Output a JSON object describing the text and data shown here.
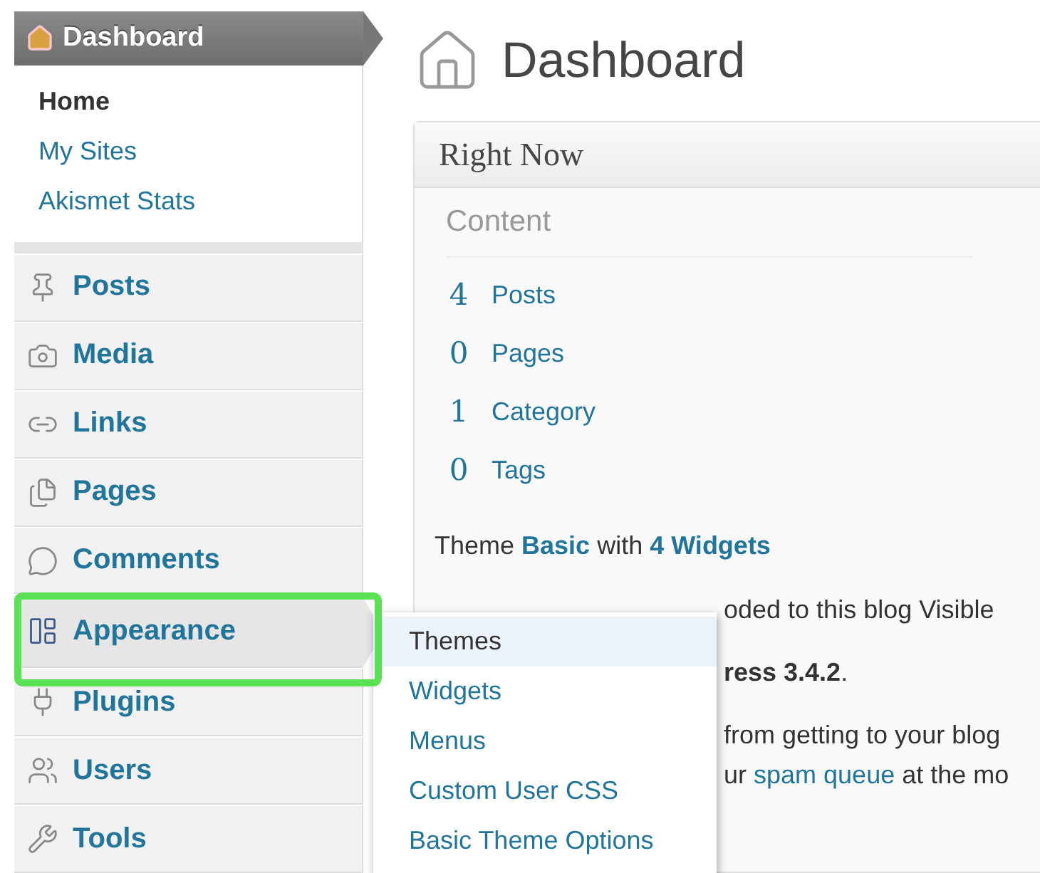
{
  "sidebar": {
    "header": {
      "label": "Dashboard"
    },
    "submenu": [
      {
        "label": "Home",
        "selected": true
      },
      {
        "label": "My Sites",
        "selected": false
      },
      {
        "label": "Akismet Stats",
        "selected": false
      }
    ],
    "menu": [
      {
        "label": "Posts",
        "expanded": false
      },
      {
        "label": "Media",
        "expanded": false
      },
      {
        "label": "Links",
        "expanded": false
      },
      {
        "label": "Pages",
        "expanded": false
      },
      {
        "label": "Comments",
        "expanded": false
      },
      {
        "label": "Appearance",
        "expanded": true
      },
      {
        "label": "Plugins",
        "expanded": false
      },
      {
        "label": "Users",
        "expanded": false
      },
      {
        "label": "Tools",
        "expanded": false
      }
    ]
  },
  "flyout": [
    {
      "label": "Themes",
      "selected": true
    },
    {
      "label": "Widgets",
      "selected": false
    },
    {
      "label": "Menus",
      "selected": false
    },
    {
      "label": "Custom User CSS",
      "selected": false
    },
    {
      "label": "Basic Theme Options",
      "selected": false
    }
  ],
  "main": {
    "title": "Dashboard",
    "panel": {
      "title": "Right Now",
      "section": "Content",
      "stats": [
        {
          "count": "4",
          "label": "Posts"
        },
        {
          "count": "0",
          "label": "Pages"
        },
        {
          "count": "1",
          "label": "Category"
        },
        {
          "count": "0",
          "label": "Tags"
        }
      ],
      "lines": [
        [
          {
            "kind": "plain",
            "text": "Theme "
          },
          {
            "kind": "bold-link",
            "text": "Basic"
          },
          {
            "kind": "plain",
            "text": " with "
          },
          {
            "kind": "bold-link",
            "text": "4 Widgets"
          }
        ],
        [
          {
            "kind": "plain",
            "text": "oded to this blog Visible"
          }
        ],
        [
          {
            "kind": "bold",
            "text": "ress 3.4.2"
          },
          {
            "kind": "plain",
            "text": "."
          }
        ],
        [
          {
            "kind": "plain",
            "text": "from getting to your blog"
          }
        ],
        [
          {
            "kind": "plain",
            "text": "ur "
          },
          {
            "kind": "link",
            "text": "spam queue"
          },
          {
            "kind": "plain",
            "text": " at the mo"
          }
        ]
      ]
    }
  }
}
